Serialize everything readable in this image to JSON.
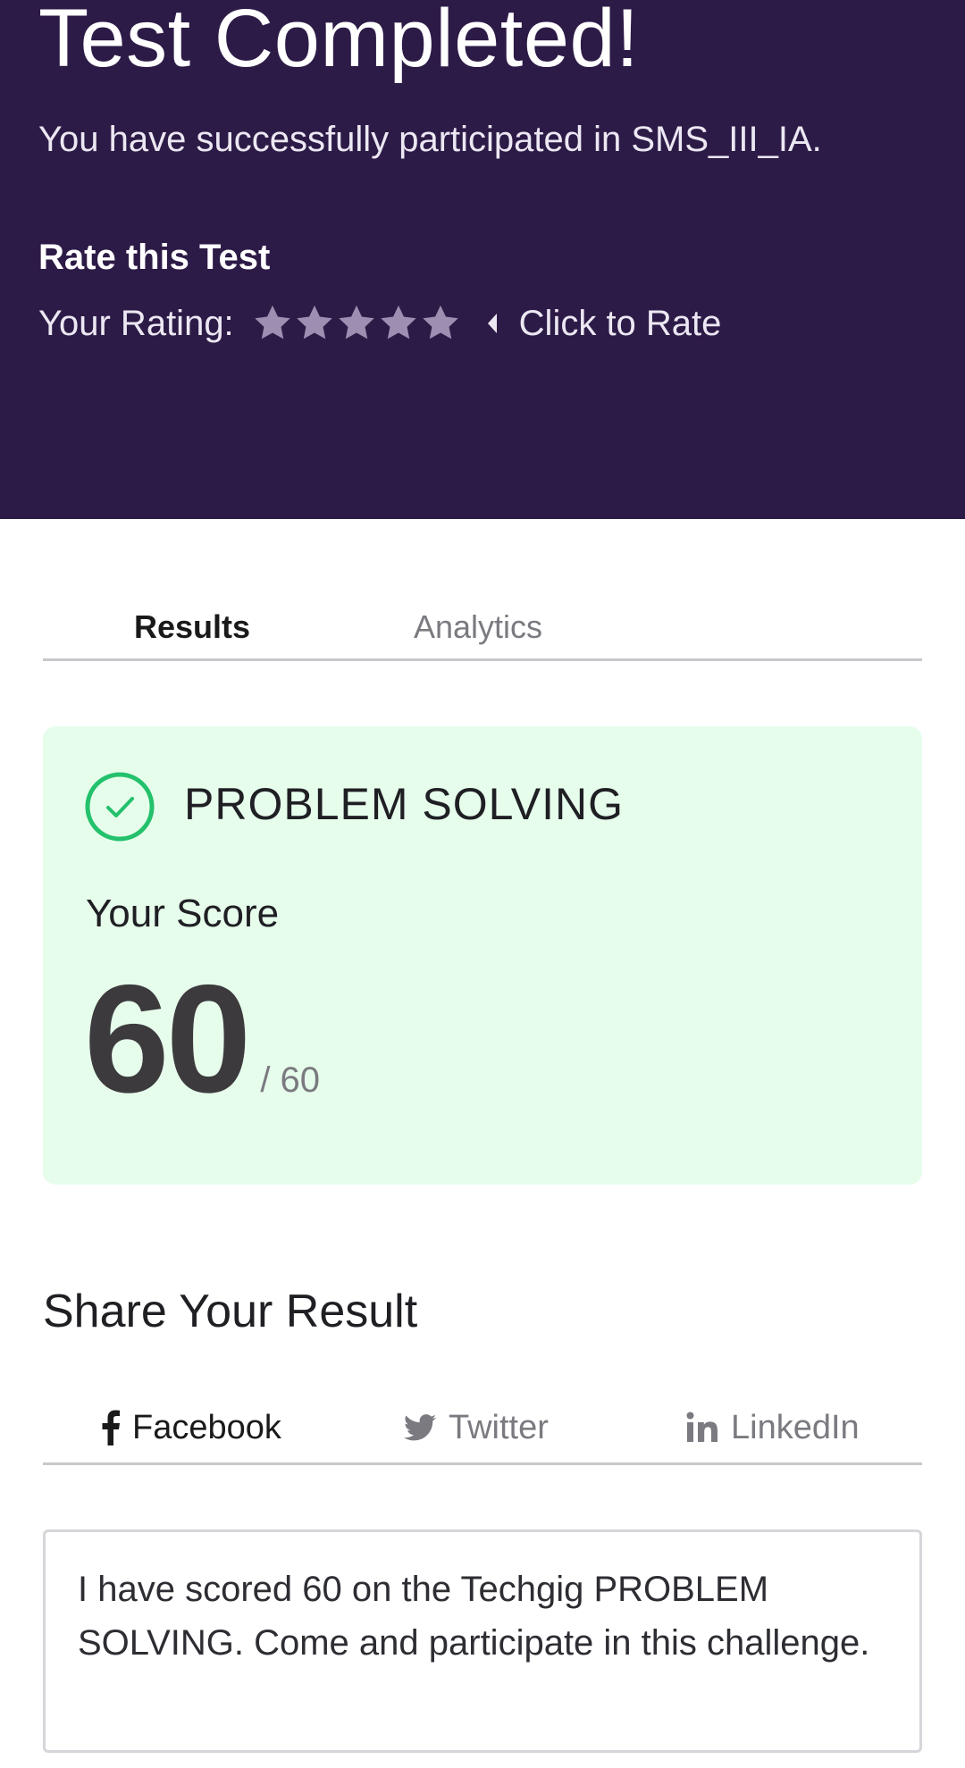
{
  "header": {
    "title": "Test Completed!",
    "subtitle": "You have successfully participated in SMS_III_IA.",
    "rate_heading": "Rate this Test",
    "rating_label": "Your Rating:",
    "rating_value": 0,
    "rating_max": 5,
    "click_to_rate": "Click to Rate",
    "colors": {
      "background": "#2d1b47",
      "star": "#9c8fb1"
    }
  },
  "tabs": [
    {
      "label": "Results",
      "active": true
    },
    {
      "label": "Analytics",
      "active": false
    }
  ],
  "score_card": {
    "icon": "check-circle-icon",
    "title": "PROBLEM SOLVING",
    "score_label": "Your Score",
    "score": "60",
    "total": "/ 60",
    "colors": {
      "background": "#e6fdec",
      "check": "#23c16b"
    }
  },
  "share": {
    "heading": "Share Your Result",
    "tabs": [
      {
        "label": "Facebook",
        "icon": "facebook-icon",
        "active": true
      },
      {
        "label": "Twitter",
        "icon": "twitter-icon",
        "active": false
      },
      {
        "label": "LinkedIn",
        "icon": "linkedin-icon",
        "active": false
      }
    ],
    "message": "I have scored 60 on the Techgig PROBLEM SOLVING. Come and participate in this challenge."
  }
}
